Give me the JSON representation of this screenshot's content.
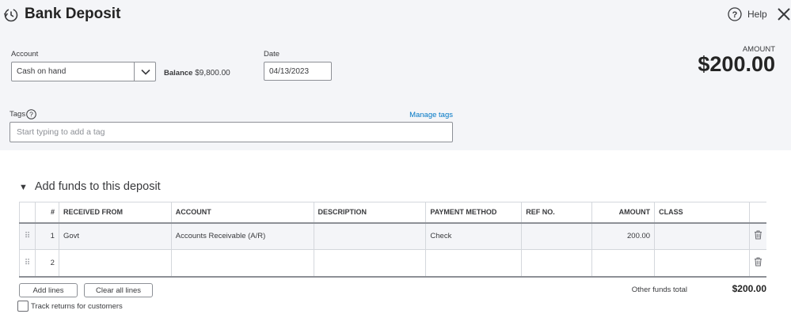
{
  "header": {
    "title": "Bank Deposit",
    "help_label": "Help",
    "amount_label": "AMOUNT",
    "amount_value": "$200.00"
  },
  "account": {
    "label": "Account",
    "value": "Cash on hand",
    "balance_label": "Balance",
    "balance_value": "$9,800.00"
  },
  "date": {
    "label": "Date",
    "value": "04/13/2023"
  },
  "tags": {
    "label": "Tags",
    "manage_label": "Manage tags",
    "placeholder": "Start typing to add a tag"
  },
  "section": {
    "title": "Add funds to this deposit"
  },
  "table": {
    "headers": [
      "#",
      "RECEIVED FROM",
      "ACCOUNT",
      "DESCRIPTION",
      "PAYMENT METHOD",
      "REF NO.",
      "AMOUNT",
      "CLASS"
    ],
    "rows": [
      {
        "num": "1",
        "received_from": "Govt",
        "account": "Accounts Receivable (A/R)",
        "description": "",
        "payment_method": "Check",
        "ref_no": "",
        "amount": "200.00",
        "class": ""
      },
      {
        "num": "2",
        "received_from": "",
        "account": "",
        "description": "",
        "payment_method": "",
        "ref_no": "",
        "amount": "",
        "class": ""
      }
    ]
  },
  "footer": {
    "add_lines_label": "Add lines",
    "clear_lines_label": "Clear all lines",
    "track_returns_label": "Track returns for customers",
    "other_funds_label": "Other funds total",
    "other_funds_value": "$200.00"
  },
  "icons": {
    "history": "history-icon",
    "help": "help-circle-icon",
    "close": "close-icon",
    "dropdown": "chevron-down-icon",
    "drag": "drag-handle-icon",
    "trash": "trash-icon"
  },
  "colors": {
    "header_bg": "#f4f5f8",
    "link": "#0077c5",
    "text": "#393a3d"
  }
}
